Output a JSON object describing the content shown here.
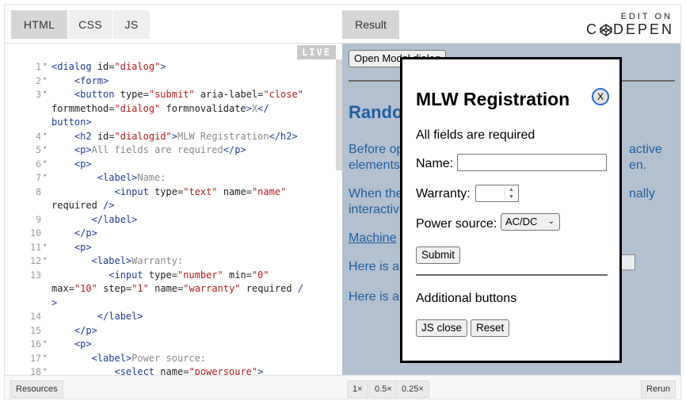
{
  "editor": {
    "tabs": [
      "HTML",
      "CSS",
      "JS"
    ],
    "live_label": "LIVE",
    "footer": {
      "resources": "Resources"
    },
    "lines": [
      {
        "n": "1",
        "fold": true,
        "html": "<span class='t'>&lt;dialog</span> <span class='a'>id</span>=<span class='v'>\"dialog\"</span><span class='t'>&gt;</span>"
      },
      {
        "n": "2",
        "fold": true,
        "html": "    <span class='t'>&lt;form&gt;</span>"
      },
      {
        "n": "3",
        "fold": true,
        "html": "    <span class='t'>&lt;button</span> <span class='a'>type</span>=<span class='v'>\"submit\"</span> <span class='a'>aria-label</span>=<span class='v'>\"close\"</span>"
      },
      {
        "n": "",
        "fold": false,
        "html": "<span class='a'>formmethod</span>=<span class='v'>\"dialog\"</span> <span class='a'>formnovalidate</span><span class='t'>&gt;</span><span class='c'>X</span><span class='t'>&lt;/</span>"
      },
      {
        "n": "",
        "fold": false,
        "html": "<span class='t'>button&gt;</span>"
      },
      {
        "n": "4",
        "fold": true,
        "html": "    <span class='t'>&lt;h2</span> <span class='a'>id</span>=<span class='v'>\"dialogid\"</span><span class='t'>&gt;</span><span class='c'>MLW Registration</span><span class='t'>&lt;/h2&gt;</span>"
      },
      {
        "n": "5",
        "fold": true,
        "html": "    <span class='t'>&lt;p&gt;</span><span class='c'>All fields are required</span><span class='t'>&lt;/p&gt;</span>"
      },
      {
        "n": "6",
        "fold": true,
        "html": "    <span class='t'>&lt;p&gt;</span>"
      },
      {
        "n": "7",
        "fold": true,
        "html": "        <span class='t'>&lt;label&gt;</span><span class='c'>Name:</span>"
      },
      {
        "n": "8",
        "fold": false,
        "html": "           <span class='t'>&lt;input</span> <span class='a'>type</span>=<span class='v'>\"text\"</span> <span class='a'>name</span>=<span class='v'>\"name\"</span>"
      },
      {
        "n": "",
        "fold": false,
        "html": "<span class='a'>required</span> <span class='t'>/&gt;</span>"
      },
      {
        "n": "9",
        "fold": false,
        "html": "       <span class='t'>&lt;/label&gt;</span>"
      },
      {
        "n": "10",
        "fold": false,
        "html": "    <span class='t'>&lt;/p&gt;</span>"
      },
      {
        "n": "11",
        "fold": true,
        "html": "    <span class='t'>&lt;p&gt;</span>"
      },
      {
        "n": "12",
        "fold": true,
        "html": "       <span class='t'>&lt;label&gt;</span><span class='c'>Warranty:</span>"
      },
      {
        "n": "13",
        "fold": false,
        "html": "          <span class='t'>&lt;input</span> <span class='a'>type</span>=<span class='v'>\"number\"</span> <span class='a'>min</span>=<span class='v'>\"0\"</span>"
      },
      {
        "n": "",
        "fold": false,
        "html": "<span class='a'>max</span>=<span class='v'>\"10\"</span> <span class='a'>step</span>=<span class='v'>\"1\"</span> <span class='a'>name</span>=<span class='v'>\"warranty\"</span> <span class='a'>required</span> <span class='t'>/</span>"
      },
      {
        "n": "",
        "fold": false,
        "html": "<span class='t'>&gt;</span>"
      },
      {
        "n": "14",
        "fold": false,
        "html": "        <span class='t'>&lt;/label&gt;</span>"
      },
      {
        "n": "15",
        "fold": false,
        "html": "    <span class='t'>&lt;/p&gt;</span>"
      },
      {
        "n": "16",
        "fold": true,
        "html": "    <span class='t'>&lt;p&gt;</span>"
      },
      {
        "n": "17",
        "fold": true,
        "html": "       <span class='t'>&lt;label&gt;</span><span class='c'>Power source:</span>"
      },
      {
        "n": "18",
        "fold": true,
        "html": "           <span class='t'>&lt;select</span> <span class='a'>name</span>=<span class='v'>\"powersoure\"</span><span class='t'>&gt;</span>"
      }
    ]
  },
  "result": {
    "tab": "Result",
    "brand_top": "EDIT ON",
    "brand_left": "C",
    "brand_right": "DEPEN",
    "open_button": "Open Modal dialog",
    "heading_partial": "Rando",
    "para1_line1": "Before op",
    "para1_line1_right": "active",
    "para1_line2": "elements",
    "para1_line2_right": "en.",
    "para2_line1": "When the",
    "para2_line1_right": "nally",
    "para2_line2": "interactiv",
    "link_partial": "Machine",
    "para3": "Here is a",
    "para4": "Here is a",
    "footer": {
      "zoom": [
        "1×",
        "0.5×",
        "0.25×"
      ],
      "rerun": "Rerun"
    }
  },
  "dialog": {
    "close": "X",
    "title": "MLW Registration",
    "subtitle": "All fields are required",
    "name_label": "Name:",
    "warranty_label": "Warranty:",
    "power_label": "Power source:",
    "power_value": "AC/DC",
    "submit": "Submit",
    "additional": "Additional buttons",
    "js_close": "JS close",
    "reset": "Reset"
  }
}
